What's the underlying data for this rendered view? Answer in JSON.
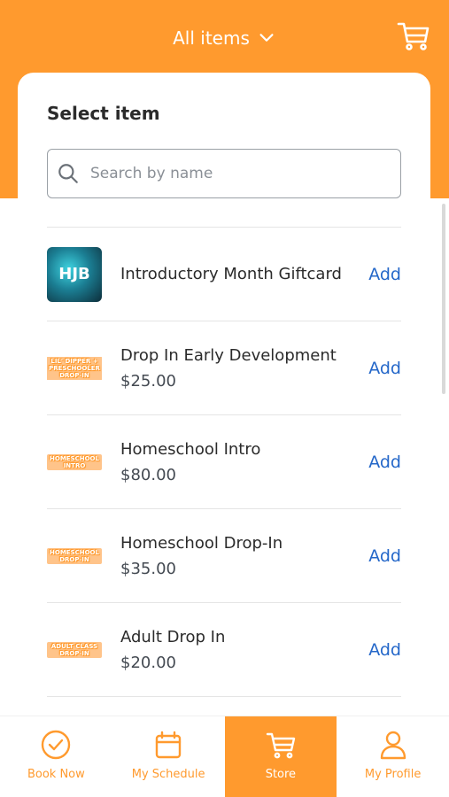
{
  "header": {
    "title": "All items",
    "chevron_icon": "chevron-down-icon",
    "cart_icon": "cart-icon"
  },
  "card": {
    "title": "Select item",
    "search": {
      "placeholder": "Search by name",
      "value": ""
    }
  },
  "items": [
    {
      "name": "Introductory Month Giftcard",
      "price": "",
      "add_label": "Add",
      "thumb": "HJB"
    },
    {
      "name": "Drop In Early Development",
      "price": "$25.00",
      "add_label": "Add",
      "thumb": "LIL' DIPPER + PRESCHOOLER DROP-IN"
    },
    {
      "name": "Homeschool Intro",
      "price": "$80.00",
      "add_label": "Add",
      "thumb": "HOMESCHOOL INTRO"
    },
    {
      "name": "Homeschool Drop-In",
      "price": "$35.00",
      "add_label": "Add",
      "thumb": "HOMESCHOOL DROP-IN"
    },
    {
      "name": "Adult Drop In",
      "price": "$20.00",
      "add_label": "Add",
      "thumb": "ADULT CLASS DROP-IN"
    }
  ],
  "tabbar": {
    "tabs": [
      {
        "label": "Book Now",
        "icon": "check-circle-icon",
        "active": false
      },
      {
        "label": "My Schedule",
        "icon": "calendar-icon",
        "active": false
      },
      {
        "label": "Store",
        "icon": "cart-icon",
        "active": true
      },
      {
        "label": "My Profile",
        "icon": "user-icon",
        "active": false
      }
    ]
  },
  "colors": {
    "brand_orange": "#ff9a2e",
    "add_blue": "#2467c9"
  }
}
